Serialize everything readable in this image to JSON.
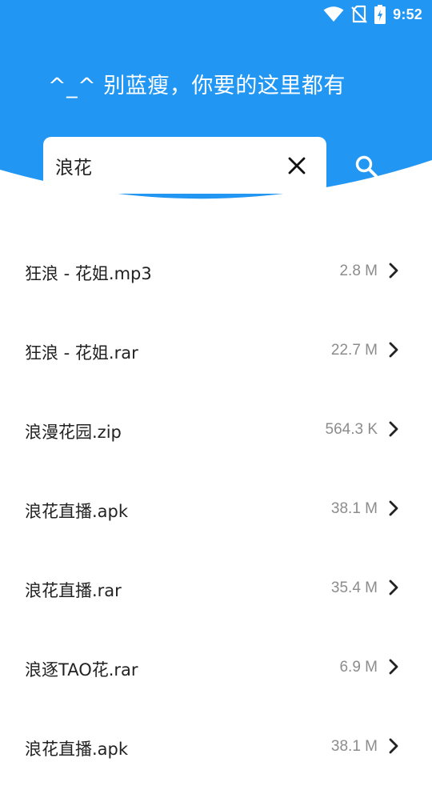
{
  "status_bar": {
    "time": "9:52",
    "icons": [
      "wifi-icon",
      "no-sim-icon",
      "battery-charging-icon"
    ]
  },
  "header": {
    "slogan": "^_^ 别蓝瘦，你要的这里都有",
    "bg_color": "#2196F3"
  },
  "search": {
    "value": "浪花",
    "clear_icon": "close-icon",
    "search_icon": "search-icon"
  },
  "results": [
    {
      "name": "狂浪 - 花姐.mp3",
      "size": "2.8 M"
    },
    {
      "name": "狂浪 - 花姐.rar",
      "size": "22.7 M"
    },
    {
      "name": "浪漫花园.zip",
      "size": "564.3 K"
    },
    {
      "name": "浪花直播.apk",
      "size": "38.1 M"
    },
    {
      "name": "浪花直播.rar",
      "size": "35.4 M"
    },
    {
      "name": "浪逐TAO花.rar",
      "size": "6.9 M"
    },
    {
      "name": "浪花直播.apk",
      "size": "38.1 M"
    }
  ]
}
